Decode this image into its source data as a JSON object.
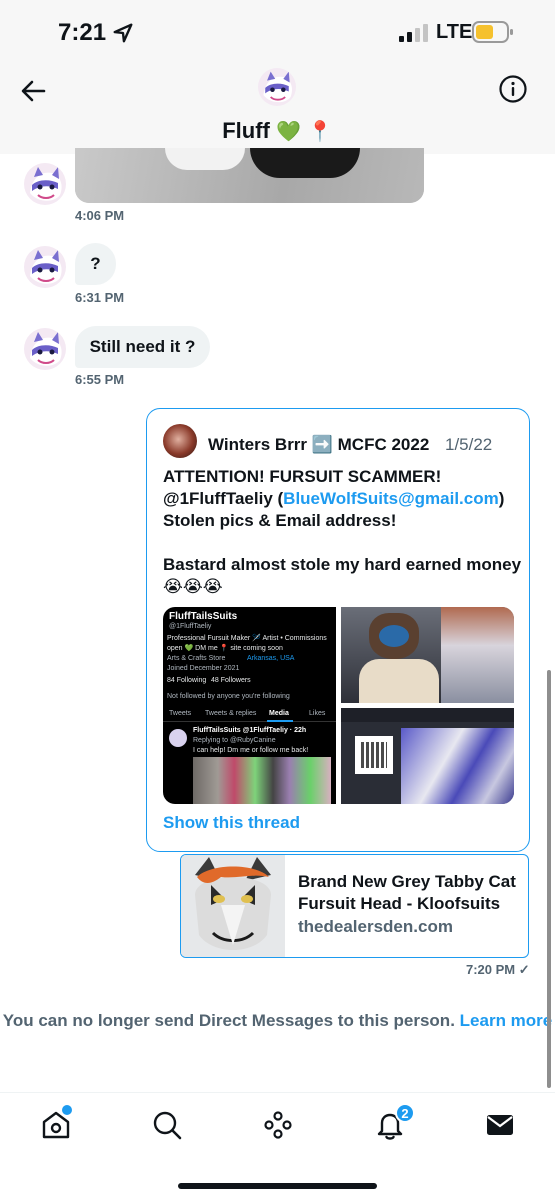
{
  "status_bar": {
    "time": "7:21",
    "carrier": "LTE"
  },
  "header": {
    "name": "Fluff",
    "name_emoji": "💚 📍"
  },
  "messages": [
    {
      "time": "4:06 PM"
    },
    {
      "text": "?",
      "time": "6:31 PM"
    },
    {
      "text": "Still need it ?",
      "time": "6:55 PM"
    }
  ],
  "quoted_tweet": {
    "author": "Winters Brrr ➡️ MCFC 2022",
    "date": "1/5/22",
    "text_line1": "ATTENTION! FURSUIT SCAMMER!",
    "handle": "@1FluffTaeliy (",
    "email": "BlueWolfSuits@gmail.com",
    "close_paren": ")",
    "text_line3": "Stolen pics & Email address!",
    "text_line4": "Bastard almost stole my hard earned money",
    "emoji_line": "😭😭😭",
    "show_thread": "Show this thread",
    "screenshot": {
      "profile_name": "FluffTailsSuits",
      "profile_handle": "@1FluffTaeliy",
      "bio": "Professional Fursuit Maker 🪡 Artist • Commissions",
      "bio2": "open 💚 DM me 📍 site coming soon",
      "category": "Arts & Crafts Store",
      "location": "Arkansas, USA",
      "joined": "Joined December 2021",
      "following": "84 Following",
      "followers": "48 Followers",
      "not_followed": "Not followed by anyone you're following",
      "tabs": [
        "Tweets",
        "Tweets & replies",
        "Media",
        "Likes"
      ],
      "reply_name": "FluffTailsSuits @1FluffTaeliy · 22h",
      "reply_to": "Replying to @RubyCanine",
      "reply_text": "I can help! Dm me or follow me back!"
    }
  },
  "link_card": {
    "title": "Brand New Grey Tabby Cat Fursuit Head - Kloofsuits",
    "domain": "thedealersden.com"
  },
  "sent_time": "7:20 PM",
  "sent_check": "✓",
  "notice": {
    "text": "You can no longer send Direct Messages to this person.",
    "link": "Learn more"
  },
  "tab_bar": {
    "notifications_badge": "2"
  }
}
